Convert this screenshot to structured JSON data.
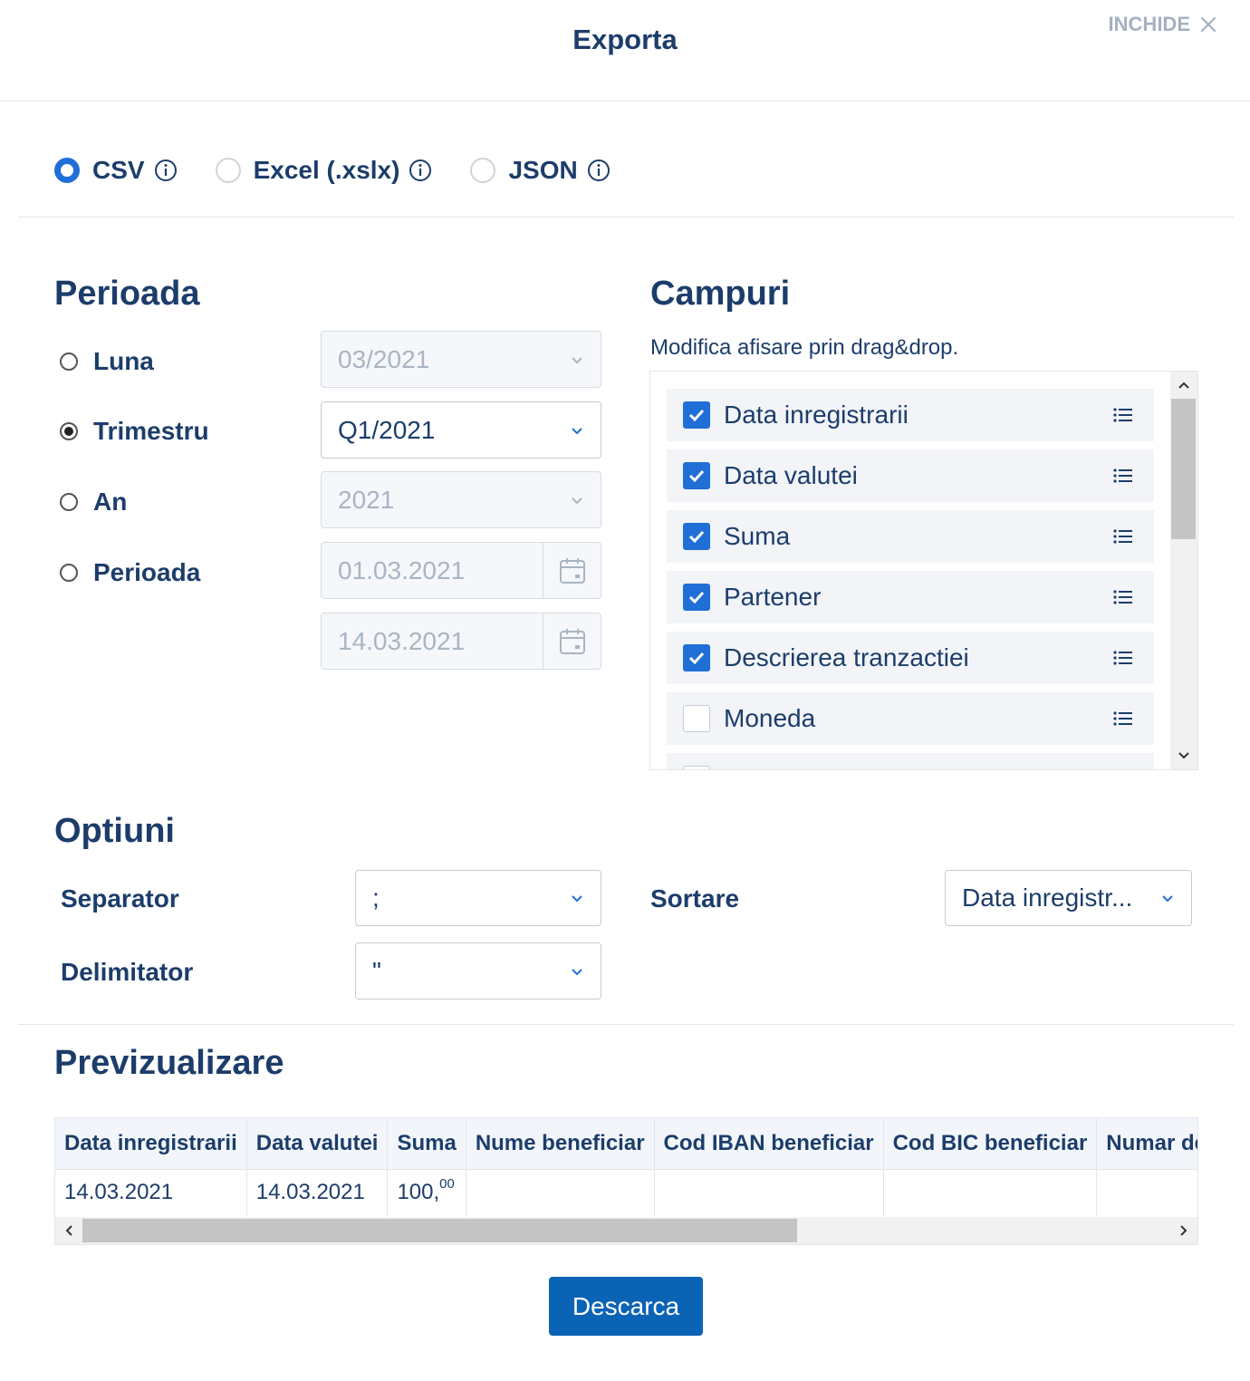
{
  "header": {
    "title": "Exporta",
    "close_label": "INCHIDE"
  },
  "formats": [
    {
      "label": "CSV",
      "selected": true
    },
    {
      "label": "Excel (.xslx)",
      "selected": false
    },
    {
      "label": "JSON",
      "selected": false
    }
  ],
  "period": {
    "heading": "Perioada",
    "options": [
      {
        "label": "Luna",
        "selected": false,
        "value": "03/2021",
        "disabled": true
      },
      {
        "label": "Trimestru",
        "selected": true,
        "value": "Q1/2021",
        "disabled": false
      },
      {
        "label": "An",
        "selected": false,
        "value": "2021",
        "disabled": true
      },
      {
        "label": "Perioada",
        "selected": false,
        "value": "01.03.2021",
        "disabled": true
      }
    ],
    "end_date": "14.03.2021"
  },
  "fields": {
    "heading": "Campuri",
    "subtitle": "Modifica afisare prin drag&drop.",
    "items": [
      {
        "label": "Data inregistrarii",
        "checked": true
      },
      {
        "label": "Data valutei",
        "checked": true
      },
      {
        "label": "Suma",
        "checked": true
      },
      {
        "label": "Partener",
        "checked": true
      },
      {
        "label": "Descrierea tranzactiei",
        "checked": true
      },
      {
        "label": "Moneda",
        "checked": false
      }
    ]
  },
  "options": {
    "heading": "Optiuni",
    "separator_label": "Separator",
    "separator_value": ";",
    "delimiter_label": "Delimitator",
    "delimiter_value": "\"",
    "sort_label": "Sortare",
    "sort_value": "Data inregistr..."
  },
  "preview": {
    "heading": "Previzualizare",
    "columns": [
      "Data inregistrarii",
      "Data valutei",
      "Suma",
      "Nume beneficiar",
      "Cod IBAN beneficiar",
      "Cod BIC beneficiar",
      "Numar de"
    ],
    "row": {
      "data_inregistrarii": "14.03.2021",
      "data_valutei": "14.03.2021",
      "suma_int": "100,",
      "suma_dec": "00"
    }
  },
  "actions": {
    "download_label": "Descarca"
  },
  "colors": {
    "primary": "#1f6fd6",
    "button": "#0b63b5",
    "text": "#1c3d6b",
    "muted": "#a3b1c2"
  }
}
